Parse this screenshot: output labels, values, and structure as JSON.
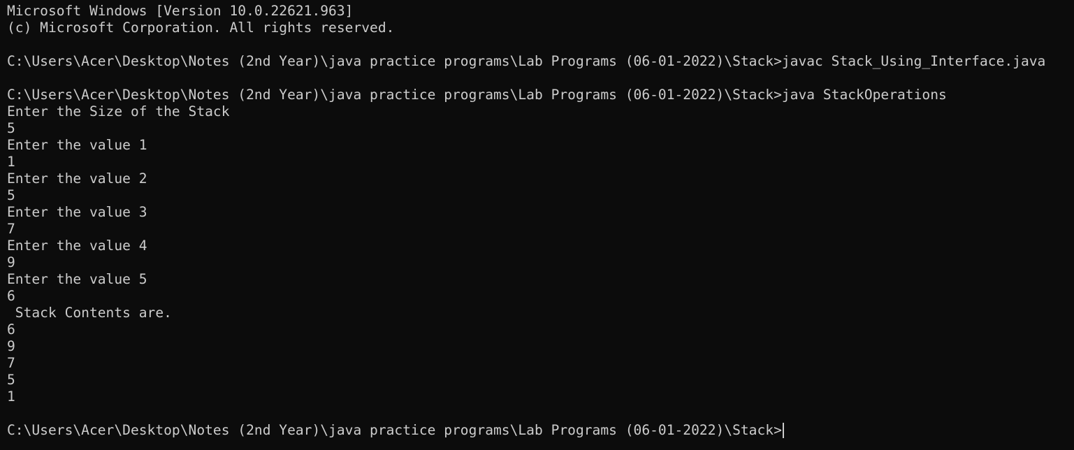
{
  "colors": {
    "background": "#0c0c0c",
    "foreground": "#cccccc"
  },
  "terminal": {
    "lines": [
      "Microsoft Windows [Version 10.0.22621.963]",
      "(c) Microsoft Corporation. All rights reserved.",
      "",
      "C:\\Users\\Acer\\Desktop\\Notes (2nd Year)\\java practice programs\\Lab Programs (06-01-2022)\\Stack>javac Stack_Using_Interface.java",
      "",
      "C:\\Users\\Acer\\Desktop\\Notes (2nd Year)\\java practice programs\\Lab Programs (06-01-2022)\\Stack>java StackOperations",
      "Enter the Size of the Stack",
      "5",
      "Enter the value 1",
      "1",
      "Enter the value 2",
      "5",
      "Enter the value 3",
      "7",
      "Enter the value 4",
      "9",
      "Enter the value 5",
      "6",
      " Stack Contents are.",
      "6",
      "9",
      "7",
      "5",
      "1",
      ""
    ],
    "prompt": "C:\\Users\\Acer\\Desktop\\Notes (2nd Year)\\java practice programs\\Lab Programs (06-01-2022)\\Stack>"
  }
}
